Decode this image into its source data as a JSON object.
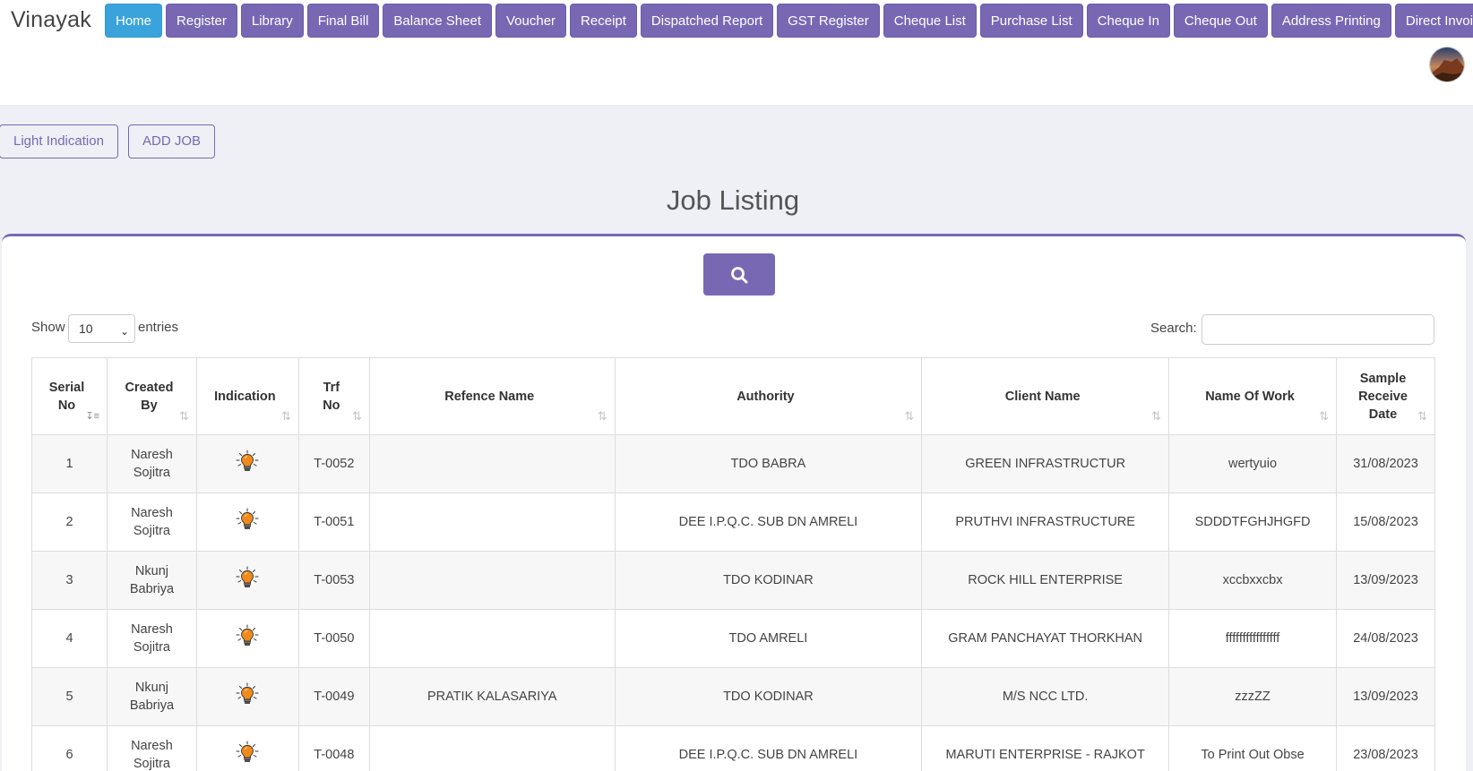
{
  "brand": "Vinayak",
  "nav": [
    {
      "label": "Home",
      "active": true
    },
    {
      "label": "Register"
    },
    {
      "label": "Library"
    },
    {
      "label": "Final Bill"
    },
    {
      "label": "Balance Sheet"
    },
    {
      "label": "Voucher"
    },
    {
      "label": "Receipt"
    },
    {
      "label": "Dispatched Report"
    },
    {
      "label": "GST Register"
    },
    {
      "label": "Cheque List"
    },
    {
      "label": "Purchase List"
    },
    {
      "label": "Cheque In"
    },
    {
      "label": "Cheque Out"
    },
    {
      "label": "Address Printing"
    },
    {
      "label": "Direct Invoice"
    }
  ],
  "actions": {
    "light_indication": "Light Indication",
    "add_job": "ADD JOB"
  },
  "page_title": "Job Listing",
  "controls": {
    "show_label": "Show",
    "entries_value": "10",
    "entries_label": "entries",
    "search_label": "Search:",
    "search_value": ""
  },
  "table": {
    "headers": [
      {
        "label": "Serial No",
        "lines": [
          "Serial",
          "No"
        ],
        "sort": "asc"
      },
      {
        "label": "Created By",
        "lines": [
          "Created",
          "By"
        ],
        "sort": "none"
      },
      {
        "label": "Indication",
        "lines": [
          "Indication"
        ],
        "sort": "none"
      },
      {
        "label": "Trf No",
        "lines": [
          "Trf",
          "No"
        ],
        "sort": "none"
      },
      {
        "label": "Refence Name",
        "lines": [
          "Refence Name"
        ],
        "sort": "none"
      },
      {
        "label": "Authority",
        "lines": [
          "Authority"
        ],
        "sort": "none"
      },
      {
        "label": "Client Name",
        "lines": [
          "Client Name"
        ],
        "sort": "none"
      },
      {
        "label": "Name Of Work",
        "lines": [
          "Name Of Work"
        ],
        "sort": "none"
      },
      {
        "label": "Sample Receive Date",
        "lines": [
          "Sample",
          "Receive",
          "Date"
        ],
        "sort": "none"
      }
    ],
    "rows": [
      {
        "serial": "1",
        "created_by": [
          "Naresh",
          "Sojitra"
        ],
        "trf": "T-0052",
        "reference": "",
        "authority": "TDO BABRA",
        "client": "GREEN INFRASTRUCTUR",
        "work": "wertyuio",
        "date": "31/08/2023"
      },
      {
        "serial": "2",
        "created_by": [
          "Naresh",
          "Sojitra"
        ],
        "trf": "T-0051",
        "reference": "",
        "authority": "DEE I.P.Q.C. SUB DN AMRELI",
        "client": "PRUTHVI INFRASTRUCTURE",
        "work": "SDDDTFGHJHGFD",
        "date": "15/08/2023"
      },
      {
        "serial": "3",
        "created_by": [
          "Nkunj",
          "Babriya"
        ],
        "trf": "T-0053",
        "reference": "",
        "authority": "TDO KODINAR",
        "client": "ROCK HILL ENTERPRISE",
        "work": "xccbxxcbx",
        "date": "13/09/2023"
      },
      {
        "serial": "4",
        "created_by": [
          "Naresh",
          "Sojitra"
        ],
        "trf": "T-0050",
        "reference": "",
        "authority": "TDO AMRELI",
        "client": "GRAM PANCHAYAT THORKHAN",
        "work": "ffffffffffffffff",
        "date": "24/08/2023"
      },
      {
        "serial": "5",
        "created_by": [
          "Nkunj",
          "Babriya"
        ],
        "trf": "T-0049",
        "reference": "PRATIK KALASARIYA",
        "authority": "TDO KODINAR",
        "client": "M/S NCC LTD.",
        "work": "zzzZZ",
        "date": "13/09/2023"
      },
      {
        "serial": "6",
        "created_by": [
          "Naresh",
          "Sojitra"
        ],
        "trf": "T-0048",
        "reference": "",
        "authority": "DEE I.P.Q.C. SUB DN AMRELI",
        "client": "MARUTI ENTERPRISE - RAJKOT",
        "work": "To Print Out Obse",
        "date": "23/08/2023"
      }
    ]
  },
  "colors": {
    "accent": "#7868b4",
    "active_nav": "#3aa3db",
    "bulb": "#f08a1c"
  }
}
